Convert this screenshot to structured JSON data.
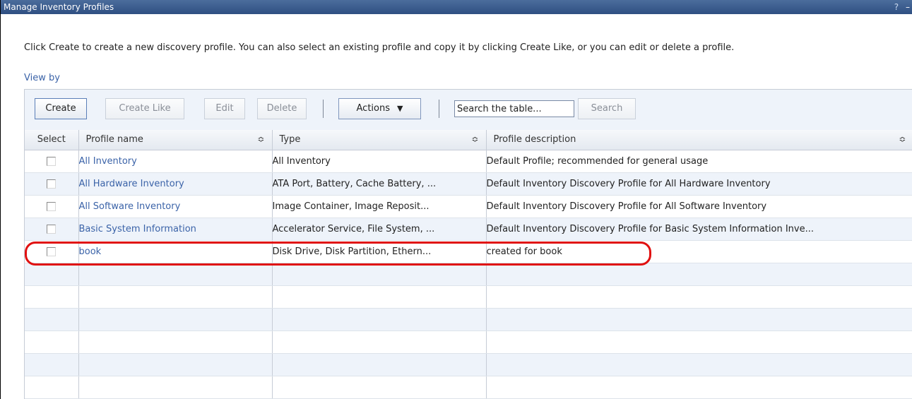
{
  "window": {
    "title": "Manage Inventory Profiles",
    "help_label": "?",
    "minimize_label": "–"
  },
  "intro_text": "Click Create to create a new discovery profile. You can also select an existing profile and copy it by clicking Create Like, or you can edit or delete a profile.",
  "view_by_label": "View by",
  "toolbar": {
    "create_label": "Create",
    "create_like_label": "Create Like",
    "edit_label": "Edit",
    "delete_label": "Delete",
    "actions_label": "Actions",
    "actions_arrow": "▼",
    "search_value": "Search the table...",
    "search_button_label": "Search"
  },
  "table": {
    "columns": {
      "select": "Select",
      "profile_name": "Profile name",
      "type": "Type",
      "description": "Profile description"
    },
    "sort_icon": "≎",
    "rows": [
      {
        "name": "All Inventory",
        "type": "All Inventory",
        "description": "Default Profile; recommended for general usage"
      },
      {
        "name": "All Hardware Inventory",
        "type": "ATA Port, Battery, Cache Battery, ...",
        "description": "Default Inventory Discovery Profile for All Hardware Inventory"
      },
      {
        "name": "All Software Inventory",
        "type": "Image Container, Image Reposit...",
        "description": "Default Inventory Discovery Profile for All Software Inventory"
      },
      {
        "name": "Basic System Information",
        "type": "Accelerator Service, File System, ...",
        "description": "Default Inventory Discovery Profile for Basic System Information Inve..."
      },
      {
        "name": "book",
        "type": "Disk Drive, Disk Partition, Ethern...",
        "description": "created for book"
      }
    ]
  },
  "colors": {
    "title_bar": "#3a5b8e",
    "link": "#3b63a8",
    "toolbar_bg": "#eef3fa",
    "highlight": "#e01010"
  }
}
